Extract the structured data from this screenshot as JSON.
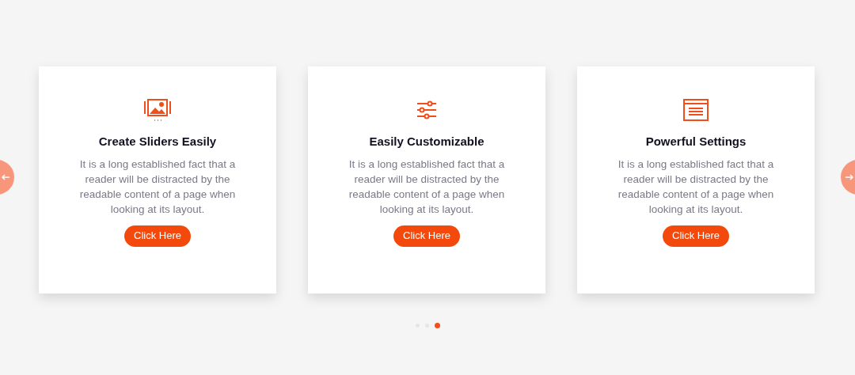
{
  "cards": [
    {
      "title": "Create Sliders Easily",
      "text": "It is a long established fact that a reader will be distracted by the readable content of a page when looking at its layout.",
      "button": "Click Here"
    },
    {
      "title": "Easily Customizable",
      "text": "It is a long established fact that a reader will be distracted by the readable content of a page when looking at its layout.",
      "button": "Click Here"
    },
    {
      "title": "Powerful Settings",
      "text": "It is a long established fact that a reader will be distracted by the readable content of a page when looking at its layout.",
      "button": "Click Here"
    }
  ],
  "dots": [
    {
      "selected": false
    },
    {
      "selected": false
    },
    {
      "selected": true
    }
  ]
}
